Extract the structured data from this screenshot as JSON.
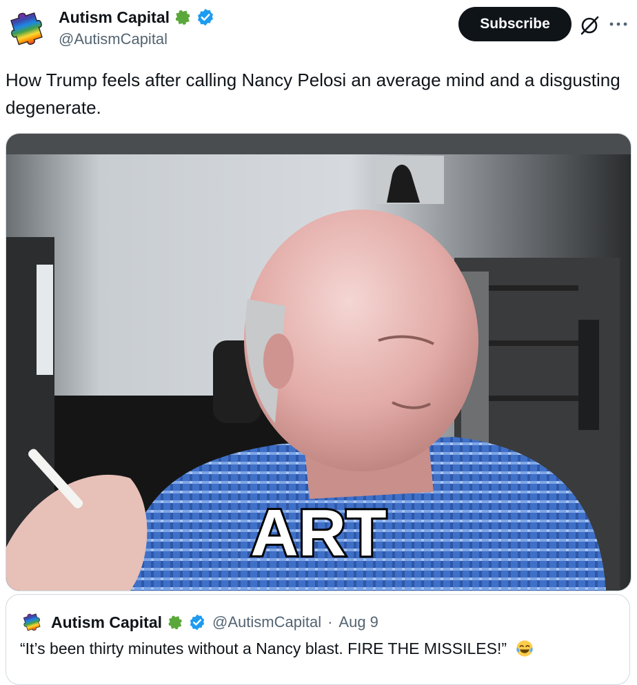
{
  "author": {
    "name": "Autism Capital",
    "handle": "@AutismCapital"
  },
  "actions": {
    "subscribe_label": "Subscribe"
  },
  "tweet": {
    "text": "How Trump feels after calling Nancy Pelosi an average mind and a disgusting degenerate.",
    "media": {
      "caption": "ART"
    }
  },
  "quoted_tweet": {
    "name": "Autism Capital",
    "handle": "@AutismCapital",
    "separator": "·",
    "date": "Aug 9",
    "text": "“It’s been thirty minutes without a Nancy blast. FIRE THE MISSILES!”",
    "emoji": "face-with-tears-of-joy"
  },
  "colors": {
    "verified_blue": "#1d9bf0",
    "puzzle_green": "#5aa83a",
    "subscribe_bg": "#0f1419",
    "secondary_text": "#536471",
    "border": "#cfd9de"
  },
  "icons": [
    "rainbow-puzzle-avatar",
    "puzzle-piece-icon",
    "verified-badge-icon",
    "grok-icon",
    "more-icon"
  ]
}
